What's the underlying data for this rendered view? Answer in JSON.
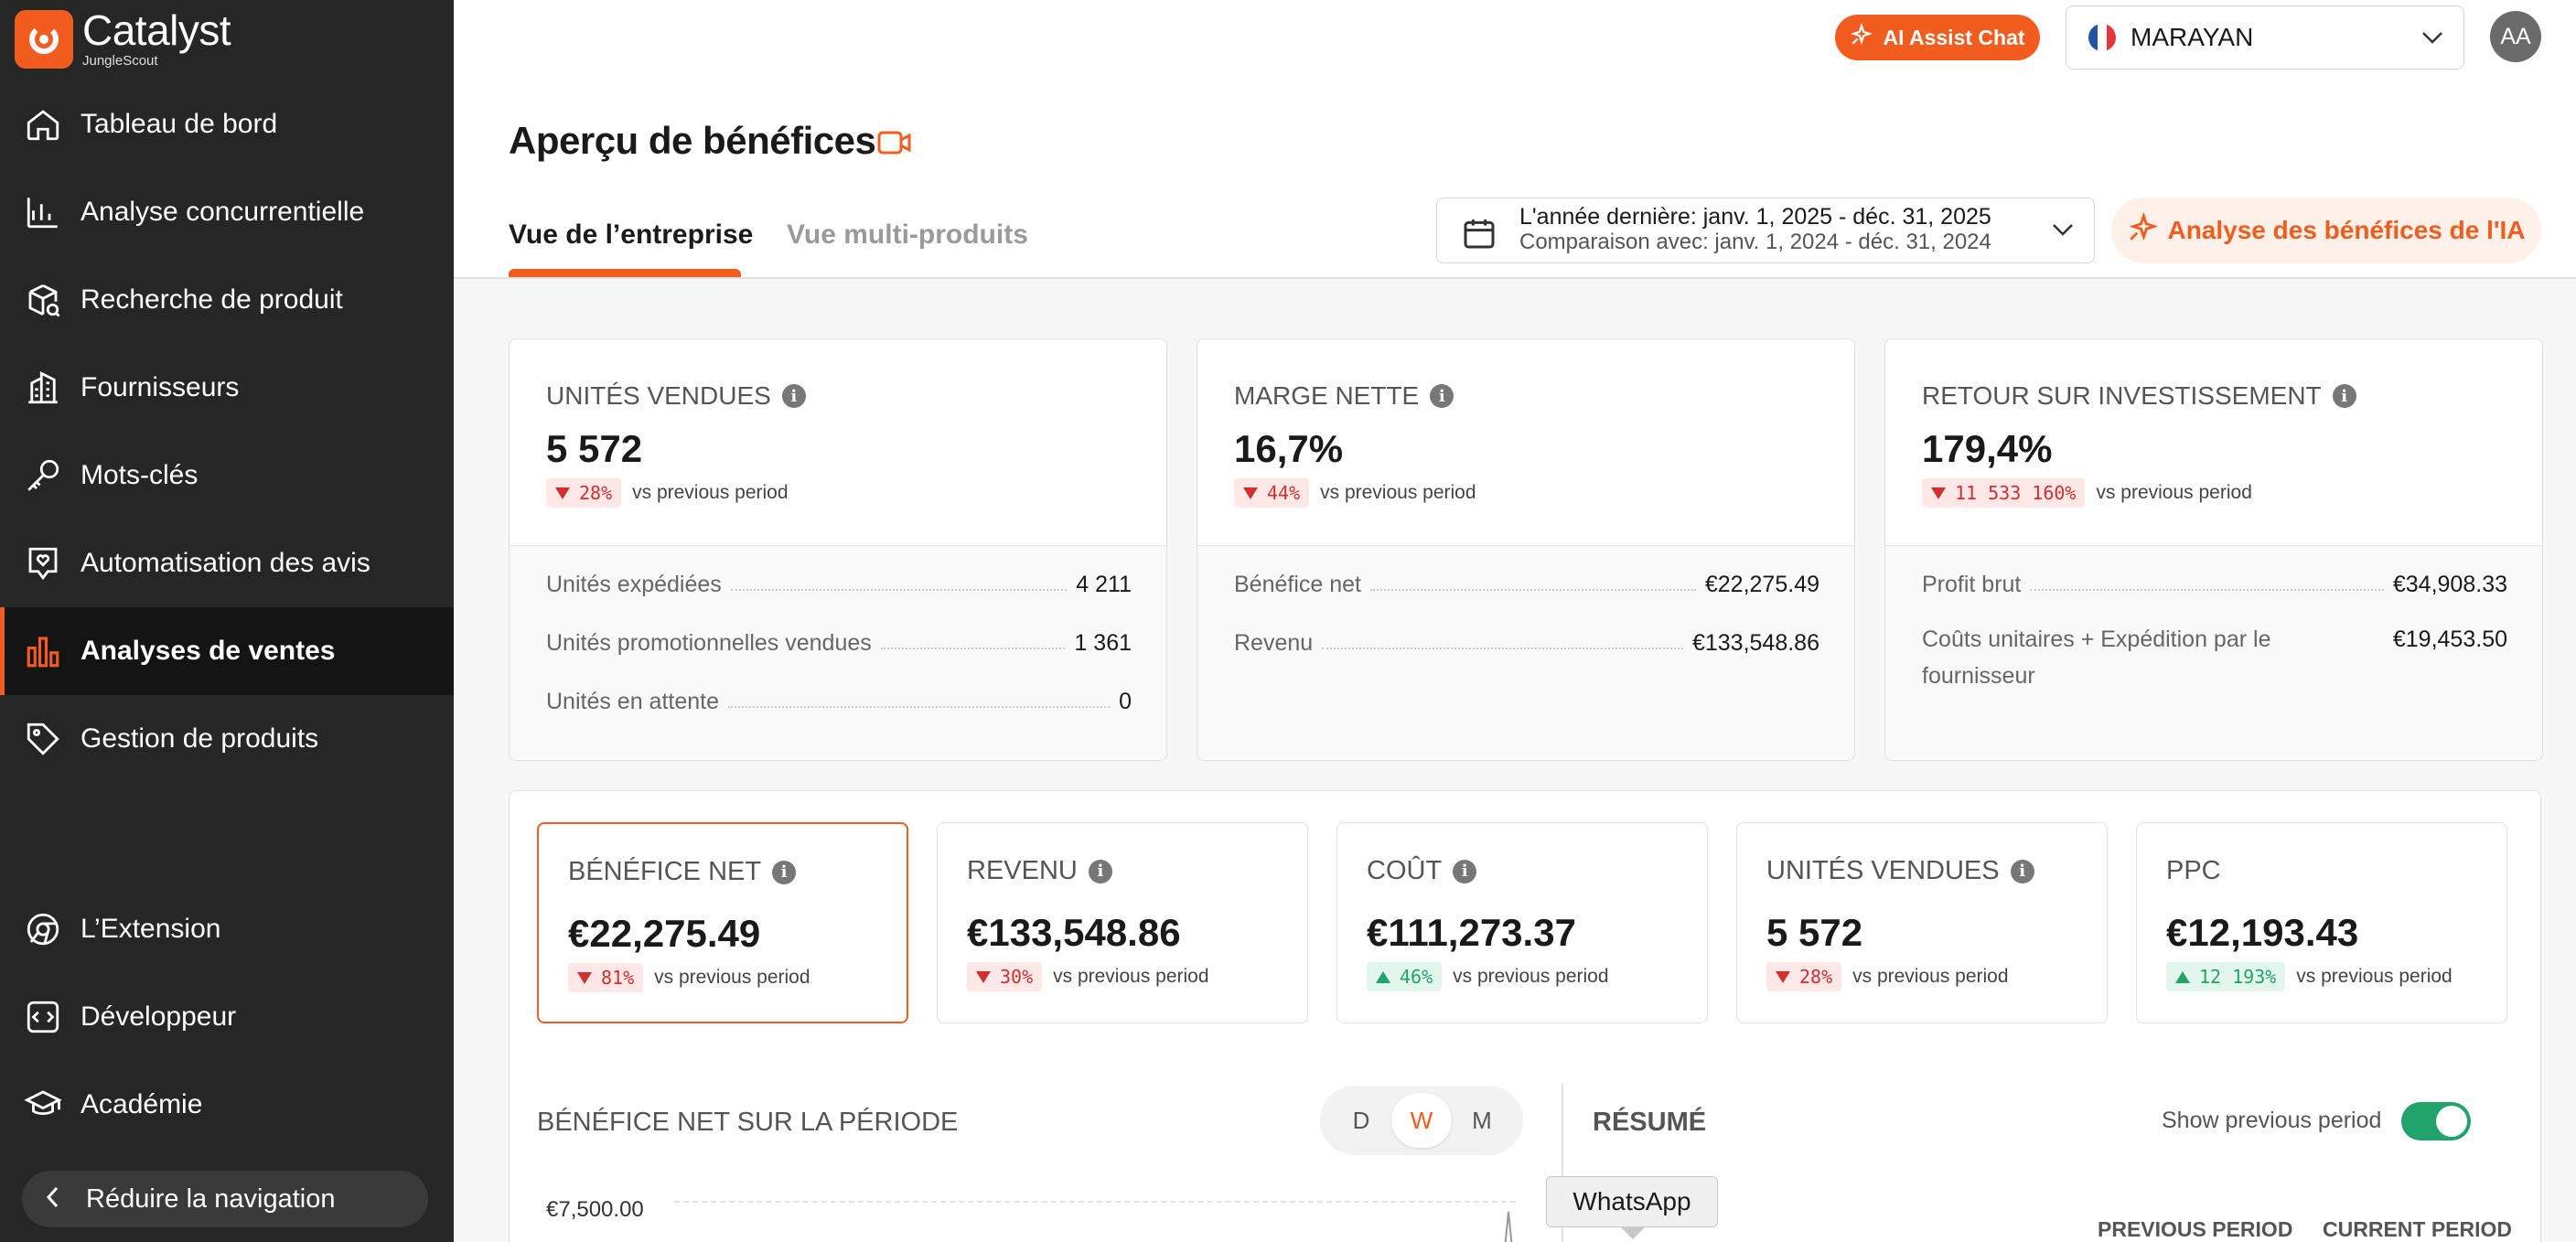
{
  "brand": {
    "name": "Catalyst",
    "sub": "JungleScout"
  },
  "sidebar": {
    "items": [
      {
        "label": "Tableau de bord",
        "icon": "home-icon"
      },
      {
        "label": "Analyse concurrentielle",
        "icon": "bar-chart-icon"
      },
      {
        "label": "Recherche de produit",
        "icon": "box-search-icon"
      },
      {
        "label": "Fournisseurs",
        "icon": "building-icon"
      },
      {
        "label": "Mots-clés",
        "icon": "key-icon"
      },
      {
        "label": "Automatisation des avis",
        "icon": "review-heart-icon"
      },
      {
        "label": "Analyses de ventes",
        "icon": "sales-chart-icon",
        "active": true
      },
      {
        "label": "Gestion de produits",
        "icon": "tag-icon"
      },
      {
        "label": "L’Extension",
        "icon": "chrome-icon"
      },
      {
        "label": "Développeur",
        "icon": "code-icon"
      },
      {
        "label": "Académie",
        "icon": "graduation-cap-icon"
      }
    ],
    "collapse_label": "Réduire la navigation"
  },
  "topbar": {
    "ai_chat": "AI Assist Chat",
    "market": "MARAYAN",
    "avatar": "AA"
  },
  "page": {
    "title": "Aperçu de bénéfices",
    "tabs": [
      "Vue de l’entreprise",
      "Vue multi-produits"
    ],
    "date_range": "L'année dernière: janv. 1, 2025 - déc. 31, 2025",
    "comparison": "Comparaison avec: janv. 1, 2024 - déc. 31, 2024",
    "ai_analysis": "Analyse des bénéfices de l'IA"
  },
  "kpis": [
    {
      "title": "UNITÉS VENDUES",
      "value": "5 572",
      "delta": "28%",
      "dir": "down",
      "rows": [
        {
          "label": "Unités expédiées",
          "value": "4 211"
        },
        {
          "label": "Unités promotionnelles vendues",
          "value": "1 361"
        },
        {
          "label": "Unités en attente",
          "value": "0"
        }
      ]
    },
    {
      "title": "MARGE NETTE",
      "value": "16,7%",
      "delta": "44%",
      "dir": "down",
      "rows": [
        {
          "label": "Bénéfice net",
          "value": "€22,275.49"
        },
        {
          "label": "Revenu",
          "value": "€133,548.86"
        }
      ]
    },
    {
      "title": "RETOUR SUR INVESTISSEMENT",
      "value": "179,4%",
      "delta": "11 533 160%",
      "dir": "down",
      "rows": [
        {
          "label": "Profit brut",
          "value": "€34,908.33"
        },
        {
          "label": "Coûts unitaires + Expédition par le fournisseur",
          "value": "€19,453.50"
        }
      ]
    }
  ],
  "vs_text": "vs previous period",
  "metrics": [
    {
      "title": "BÉNÉFICE NET",
      "value": "€22,275.49",
      "delta": "81%",
      "dir": "down",
      "info": true
    },
    {
      "title": "REVENU",
      "value": "€133,548.86",
      "delta": "30%",
      "dir": "down",
      "info": true
    },
    {
      "title": "COÛT",
      "value": "€111,273.37",
      "delta": "46%",
      "dir": "up",
      "info": true
    },
    {
      "title": "UNITÉS VENDUES",
      "value": "5 572",
      "delta": "28%",
      "dir": "down",
      "info": true
    },
    {
      "title": "PPC",
      "value": "€12,193.43",
      "delta": "12 193%",
      "dir": "up",
      "info": false
    }
  ],
  "chart": {
    "title": "BÉNÉFICE NET SUR LA PÉRIODE",
    "granularity": [
      "D",
      "W",
      "M"
    ],
    "selected": "W",
    "y_tick": "€7,500.00"
  },
  "summary": {
    "title": "RÉSUMÉ",
    "toggle_label": "Show previous period",
    "toggle_on": true,
    "col_prev": "PREVIOUS PERIOD",
    "col_curr": "CURRENT PERIOD"
  },
  "tooltip": "WhatsApp",
  "colors": {
    "accent": "#f25c1f",
    "down": "#d32f2f",
    "up": "#22a36b",
    "sidebar": "#262626"
  }
}
